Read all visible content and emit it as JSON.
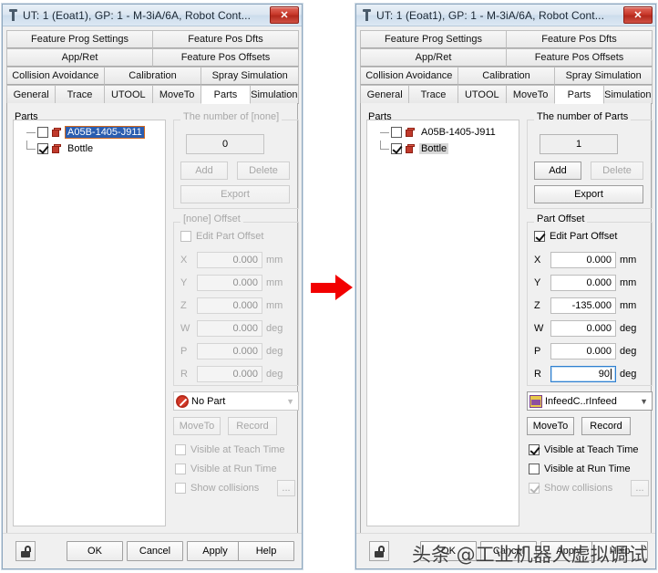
{
  "window": {
    "title": "UT: 1  (Eoat1), GP: 1 - M-3iA/6A, Robot Cont...",
    "close_label": "✕",
    "icon": "tool-icon"
  },
  "tabs": {
    "row1": [
      "Feature Prog Settings",
      "Feature Pos Dfts"
    ],
    "row2": [
      "App/Ret",
      "Feature Pos Offsets"
    ],
    "row3": [
      "Collision Avoidance",
      "Calibration",
      "Spray Simulation"
    ],
    "row4": [
      "General",
      "Trace",
      "UTOOL",
      "MoveTo",
      "Parts",
      "Simulation"
    ],
    "active": "Parts"
  },
  "left": {
    "parts_group_label": "Parts",
    "tree": [
      {
        "label": "A05B-1405-J911",
        "checked": false,
        "selected": "blue"
      },
      {
        "label": "Bottle",
        "checked": true,
        "selected": "none"
      }
    ],
    "number_group_label": "The number of [none]",
    "number_value": "0",
    "add_label": "Add",
    "delete_label": "Delete",
    "export_label": "Export",
    "offset_group_label": "[none] Offset",
    "edit_offset_label": "Edit Part Offset",
    "edit_offset_checked": false,
    "fields": [
      {
        "axis": "X",
        "value": "0.000",
        "unit": "mm"
      },
      {
        "axis": "Y",
        "value": "0.000",
        "unit": "mm"
      },
      {
        "axis": "Z",
        "value": "0.000",
        "unit": "mm"
      },
      {
        "axis": "W",
        "value": "0.000",
        "unit": "deg"
      },
      {
        "axis": "P",
        "value": "0.000",
        "unit": "deg"
      },
      {
        "axis": "R",
        "value": "0.000",
        "unit": "deg"
      }
    ],
    "combo_value": "No Part",
    "combo_icon": "no-part-icon",
    "combo_arrow": "▼",
    "moveto_label": "MoveTo",
    "record_label": "Record",
    "visible_teach_label": "Visible at Teach Time",
    "visible_teach_checked": false,
    "visible_run_label": "Visible at Run Time",
    "visible_run_checked": false,
    "show_collisions_label": "Show collisions",
    "show_collisions_checked": false,
    "dots_label": "...",
    "buttons": {
      "ok": "OK",
      "cancel": "Cancel",
      "apply": "Apply",
      "help": "Help"
    }
  },
  "right": {
    "parts_group_label": "Parts",
    "tree": [
      {
        "label": "A05B-1405-J911",
        "checked": false,
        "selected": "none"
      },
      {
        "label": "Bottle",
        "checked": true,
        "selected": "gray"
      }
    ],
    "number_group_label": "The number of Parts",
    "number_value": "1",
    "add_label": "Add",
    "delete_label": "Delete",
    "export_label": "Export",
    "offset_group_label": "Part Offset",
    "edit_offset_label": "Edit Part Offset",
    "edit_offset_checked": true,
    "fields": [
      {
        "axis": "X",
        "value": "0.000",
        "unit": "mm"
      },
      {
        "axis": "Y",
        "value": "0.000",
        "unit": "mm"
      },
      {
        "axis": "Z",
        "value": "-135.000",
        "unit": "mm"
      },
      {
        "axis": "W",
        "value": "0.000",
        "unit": "deg"
      },
      {
        "axis": "P",
        "value": "0.000",
        "unit": "deg"
      },
      {
        "axis": "R",
        "value": "90",
        "unit": "deg"
      }
    ],
    "combo_value": "InfeedC..rInfeed",
    "combo_icon": "infeed-conveyor-icon",
    "combo_arrow": "▼",
    "moveto_label": "MoveTo",
    "record_label": "Record",
    "visible_teach_label": "Visible at Teach Time",
    "visible_teach_checked": true,
    "visible_run_label": "Visible at Run Time",
    "visible_run_checked": false,
    "show_collisions_label": "Show collisions",
    "show_collisions_checked": true,
    "dots_label": "...",
    "buttons": {
      "ok": "OK",
      "cancel": "Cancel",
      "apply": "Apply",
      "help": "Help"
    }
  },
  "annotation": {
    "arrow": "red-right-arrow"
  },
  "watermark": {
    "text": "头条 @工业机器人虚拟调试"
  },
  "colors": {
    "accent_red": "#f20000",
    "selection_blue": "#2a5db0",
    "titlebar": "#dbe6f1",
    "close_red": "#c9392b"
  }
}
